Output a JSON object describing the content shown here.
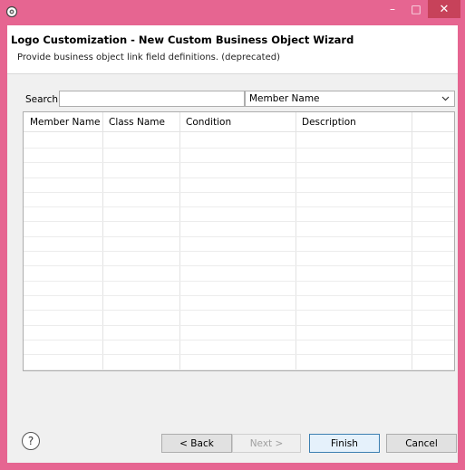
{
  "window": {
    "minimize_glyph": "–",
    "maximize_glyph": "□",
    "close_glyph": "✕",
    "app_icon": "gear-icon",
    "accent": "#e66591"
  },
  "wizard": {
    "title": "Logo Customization - New Custom Business Object Wizard",
    "description": "Provide business object link field definitions. (deprecated)"
  },
  "search": {
    "label": "Search",
    "value": "",
    "placeholder": ""
  },
  "filter_select": {
    "selected": "Member Name",
    "arrow_icon": "chevron-down-icon"
  },
  "table": {
    "columns": [
      "Member Name",
      "Class Name",
      "Condition",
      "Description",
      ""
    ],
    "rows": []
  },
  "buttons": {
    "help_glyph": "?",
    "back": "< Back",
    "next": "Next >",
    "finish": "Finish",
    "cancel": "Cancel"
  }
}
